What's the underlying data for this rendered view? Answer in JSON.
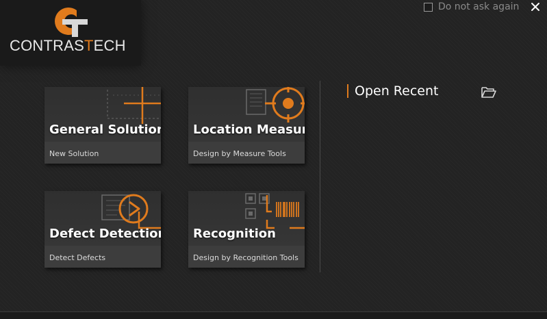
{
  "brand": {
    "logo_text_before": "CONTRAS",
    "logo_text_accent": "T",
    "logo_text_after": "ECH",
    "accent_color": "#e07b1d",
    "logo_icon": "contrastech-logo-icon"
  },
  "header": {
    "dont_ask_label": "Do not ask again",
    "dont_ask_checked": false,
    "close_icon": "close-icon"
  },
  "tiles": [
    {
      "title": "General Solution",
      "subtitle": "New Solution",
      "icon": "crosshair-icon"
    },
    {
      "title": "Location Measure",
      "subtitle": "Design by Measure Tools",
      "icon": "target-icon"
    },
    {
      "title": "Defect Detection",
      "subtitle": "Detect Defects",
      "icon": "defect-scan-icon"
    },
    {
      "title": "Recognition",
      "subtitle": "Design by Recognition Tools",
      "icon": "barcode-icon"
    }
  ],
  "recent": {
    "title": "Open Recent",
    "open_icon": "folder-open-icon"
  }
}
